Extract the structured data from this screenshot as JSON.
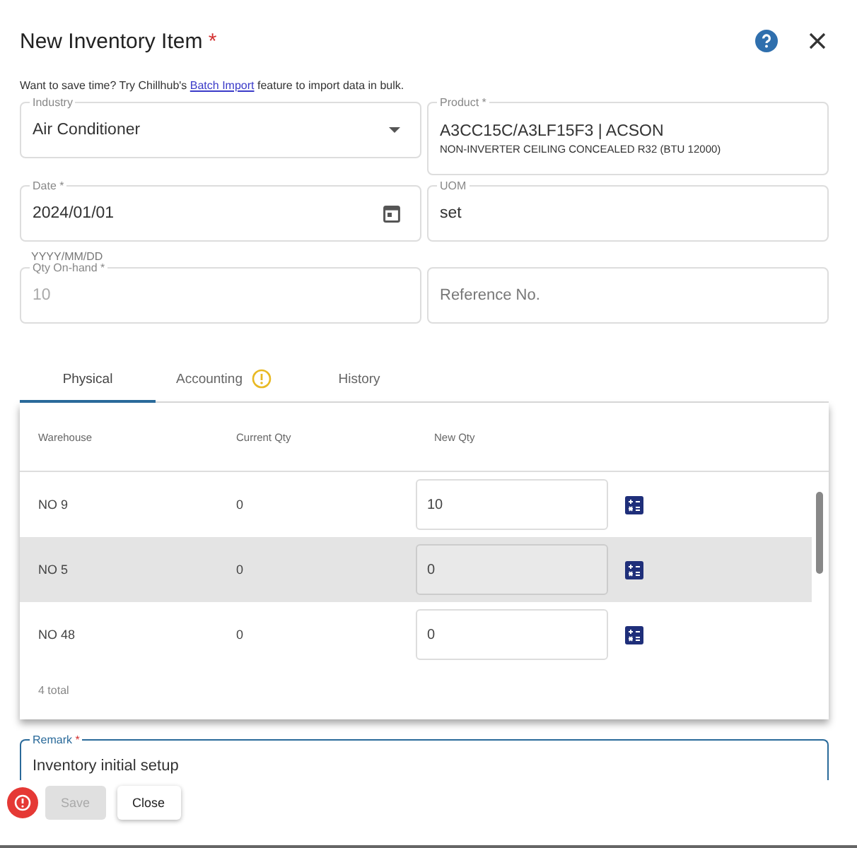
{
  "dialog": {
    "title": "New Inventory Item",
    "required_mark": "*"
  },
  "hint": {
    "before": "Want to save time? Try Chillhub's ",
    "link": "Batch Import",
    "after": " feature to import data in bulk."
  },
  "fields": [
    {
      "kind": "select",
      "label": "Industry",
      "value": "Air Conditioner"
    },
    {
      "kind": "product",
      "label": "Product *",
      "value": "A3CC15C/A3LF15F3 | ACSON",
      "subtext": "NON-INVERTER CEILING CONCEALED R32 (BTU 12000)"
    },
    {
      "kind": "date",
      "label": "Date *",
      "value": "2024/01/01",
      "helper": "YYYY/MM/DD"
    },
    {
      "kind": "text",
      "label": "UOM",
      "value": "set"
    },
    {
      "kind": "text",
      "label": "Qty On-hand *",
      "value": "10",
      "disabled": true
    },
    {
      "kind": "text",
      "placeholder": "Reference No."
    }
  ],
  "tabs": [
    {
      "label": "Physical",
      "selected": true,
      "warning": false
    },
    {
      "label": "Accounting",
      "selected": false,
      "warning": true
    },
    {
      "label": "History",
      "selected": false,
      "warning": false
    }
  ],
  "table": {
    "columns": [
      "Warehouse",
      "Current Qty",
      "New Qty"
    ],
    "rows": [
      {
        "warehouse": "NO 9",
        "current_qty": "0",
        "new_qty": "10",
        "selected": false
      },
      {
        "warehouse": "NO 5",
        "current_qty": "0",
        "new_qty": "0",
        "selected": true
      },
      {
        "warehouse": "NO 48",
        "current_qty": "0",
        "new_qty": "0",
        "selected": false
      }
    ],
    "footer": "4 total"
  },
  "remark": {
    "label": "Remark",
    "required_mark": "*",
    "value": "Inventory initial setup"
  },
  "buttons": [
    {
      "label": "Save",
      "disabled": true
    },
    {
      "label": "Close",
      "disabled": false
    }
  ],
  "error_badge": true
}
